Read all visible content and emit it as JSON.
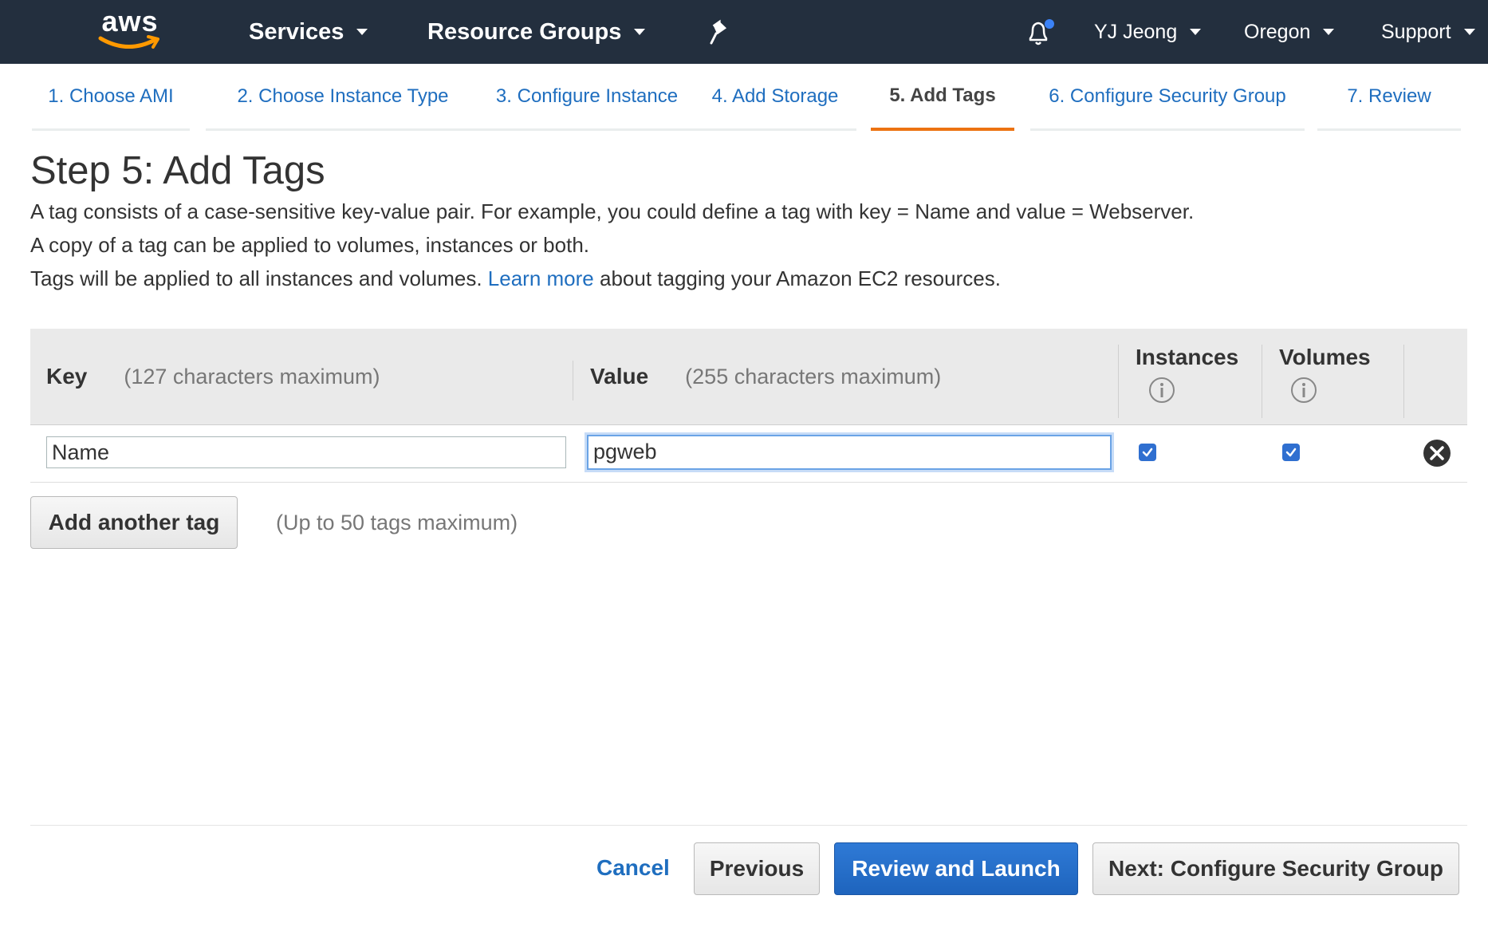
{
  "navbar": {
    "logo_text": "aws",
    "services": "Services",
    "resource_groups": "Resource Groups",
    "user": "YJ Jeong",
    "region": "Oregon",
    "support": "Support",
    "notification_dot_color": "#3b82f6"
  },
  "tabs": [
    {
      "label": "1. Choose AMI"
    },
    {
      "label": "2. Choose Instance Type"
    },
    {
      "label": "3. Configure Instance"
    },
    {
      "label": "4. Add Storage"
    },
    {
      "label": "5. Add Tags"
    },
    {
      "label": "6. Configure Security Group"
    },
    {
      "label": "7. Review"
    }
  ],
  "page": {
    "title": "Step 5: Add Tags",
    "desc1": "A tag consists of a case-sensitive key-value pair. For example, you could define a tag with key = Name and value = Webserver.",
    "desc2": "A copy of a tag can be applied to volumes, instances or both.",
    "desc3_pre": "Tags will be applied to all instances and volumes.",
    "desc3_link": "Learn more",
    "desc3_post": "about tagging your Amazon EC2 resources."
  },
  "table": {
    "key_header": "Key",
    "key_hint": "(127 characters maximum)",
    "value_header": "Value",
    "value_hint": "(255 characters maximum)",
    "instances_header": "Instances",
    "volumes_header": "Volumes",
    "rows": [
      {
        "key": "Name",
        "value": "pgweb",
        "instances": true,
        "volumes": true
      }
    ]
  },
  "actions": {
    "add_tag": "Add another tag",
    "add_tag_note": "(Up to 50 tags maximum)",
    "cancel": "Cancel",
    "previous": "Previous",
    "review_launch": "Review and Launch",
    "next": "Next: Configure Security Group"
  },
  "colors": {
    "navbar_bg": "#232f3e",
    "link": "#1f6ebf",
    "active_tab_underline": "#ec7211",
    "primary_button": "#1e64bd"
  }
}
